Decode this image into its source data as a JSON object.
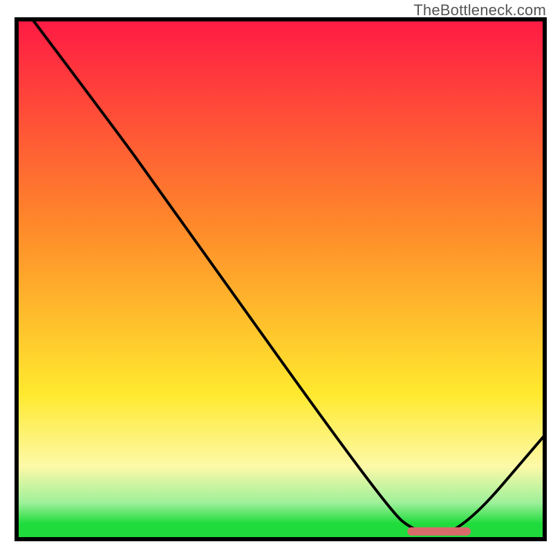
{
  "watermark": "TheBottleneck.com",
  "colors": {
    "red": "#ff1a44",
    "orange": "#ff8a2a",
    "yellow": "#ffe92e",
    "paleYellow": "#fdf9a8",
    "lightGreen": "#9ef09a",
    "green": "#1fdc3c",
    "curve": "#000000",
    "marker": "#d86a6a",
    "frame": "#000000"
  },
  "chart_data": {
    "type": "line",
    "title": "",
    "xlabel": "",
    "ylabel": "",
    "xlim": [
      0,
      100
    ],
    "ylim": [
      0,
      100
    ],
    "grid": false,
    "curve": [
      {
        "x": 3,
        "y": 100
      },
      {
        "x": 20,
        "y": 77
      },
      {
        "x": 25,
        "y": 70
      },
      {
        "x": 70,
        "y": 6
      },
      {
        "x": 76,
        "y": 1
      },
      {
        "x": 84,
        "y": 1
      },
      {
        "x": 100,
        "y": 20
      }
    ],
    "optimal_marker": {
      "x_start": 74,
      "x_end": 86,
      "y": 1.5
    },
    "gradient_stops": [
      {
        "pos": 0.0,
        "color_key": "red"
      },
      {
        "pos": 0.4,
        "color_key": "orange"
      },
      {
        "pos": 0.72,
        "color_key": "yellow"
      },
      {
        "pos": 0.86,
        "color_key": "paleYellow"
      },
      {
        "pos": 0.93,
        "color_key": "lightGreen"
      },
      {
        "pos": 0.97,
        "color_key": "green"
      }
    ]
  }
}
